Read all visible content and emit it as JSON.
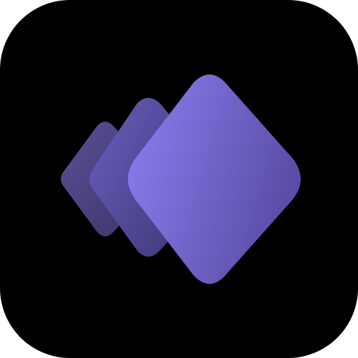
{
  "icon": {
    "name": "stacked-diamonds-app-icon",
    "background_color": "#000000",
    "outer_color": "#ffffff",
    "layers": [
      {
        "name": "back-diamond",
        "color_light": "#5a5096",
        "color_dark": "#3b3466"
      },
      {
        "name": "middle-diamond",
        "color_light": "#6a5fc0",
        "color_dark": "#3f3775"
      },
      {
        "name": "front-diamond",
        "color_light": "#8d80f2",
        "color_dark": "#5b4ea8"
      }
    ]
  }
}
